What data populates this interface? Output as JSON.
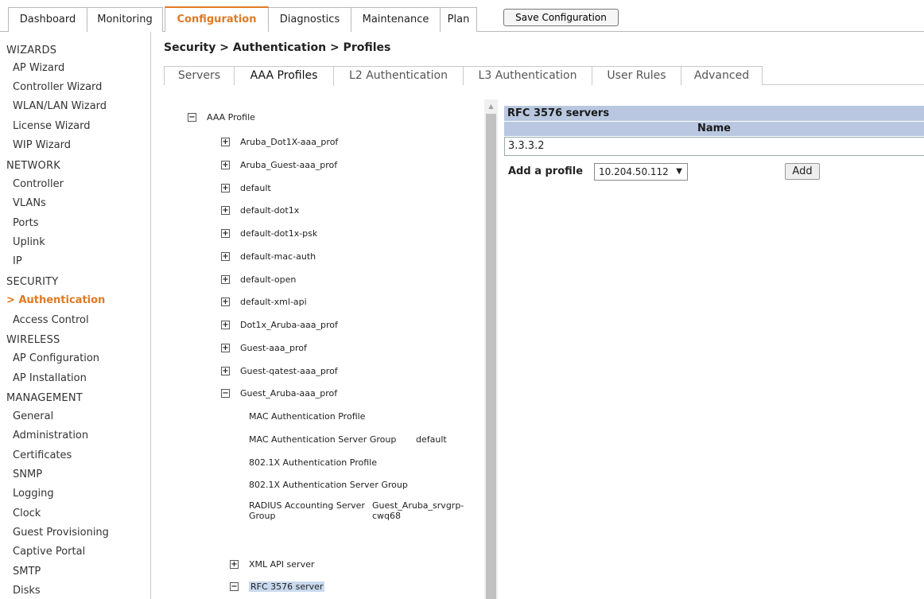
{
  "topnav": {
    "tabs": [
      {
        "label": "Dashboard"
      },
      {
        "label": "Monitoring"
      },
      {
        "label": "Configuration"
      },
      {
        "label": "Diagnostics"
      },
      {
        "label": "Maintenance"
      },
      {
        "label": "Plan"
      }
    ],
    "active_tab": "Configuration",
    "save_label": "Save Configuration"
  },
  "sidebar": {
    "sections": [
      {
        "title": "WIZARDS",
        "items": [
          "AP Wizard",
          "Controller Wizard",
          "WLAN/LAN Wizard",
          "License Wizard",
          "WIP Wizard"
        ]
      },
      {
        "title": "NETWORK",
        "items": [
          "Controller",
          "VLANs",
          "Ports",
          "Uplink",
          "IP"
        ]
      },
      {
        "title": "SECURITY",
        "items": [
          "Authentication",
          "Access Control"
        ]
      },
      {
        "title": "WIRELESS",
        "items": [
          "AP Configuration",
          "AP Installation"
        ]
      },
      {
        "title": "MANAGEMENT",
        "items": [
          "General",
          "Administration",
          "Certificates",
          "SNMP",
          "Logging",
          "Clock",
          "Guest Provisioning",
          "Captive Portal",
          "SMTP",
          "Disks"
        ]
      }
    ],
    "active_marker": ">",
    "active_item": "Authentication"
  },
  "breadcrumb": "Security > Authentication > Profiles",
  "subtabs": [
    {
      "label": "Servers"
    },
    {
      "label": "AAA Profiles"
    },
    {
      "label": "L2 Authentication"
    },
    {
      "label": "L3 Authentication"
    },
    {
      "label": "User Rules"
    },
    {
      "label": "Advanced"
    }
  ],
  "tree": {
    "root": "AAA Profile",
    "collapsed_profiles": [
      "Aruba_Dot1X-aaa_prof",
      "Aruba_Guest-aaa_prof",
      "default",
      "default-dot1x",
      "default-dot1x-psk",
      "default-mac-auth",
      "default-open",
      "default-xml-api",
      "Dot1x_Aruba-aaa_prof",
      "Guest-aaa_prof",
      "Guest-qatest-aaa_prof"
    ],
    "expanded_profile": "Guest_Aruba-aaa_prof",
    "children": [
      {
        "label": "MAC Authentication Profile",
        "value": ""
      },
      {
        "label": "MAC Authentication Server Group",
        "value": "default"
      },
      {
        "label": "802.1X Authentication Profile",
        "value": ""
      },
      {
        "label": "802.1X Authentication Server Group",
        "value": ""
      },
      {
        "label_line1": "RADIUS Accounting Server",
        "label_line2": "Group",
        "value_line1": "Guest_Aruba_srvgrp-",
        "value_line2": "cwq68"
      }
    ],
    "xml_api": "XML API server",
    "rfc_node": "RFC 3576 server",
    "expand_symbol": "+",
    "collapse_symbol": "−"
  },
  "rfc_panel": {
    "title": "RFC 3576 servers",
    "column": "Name",
    "rows": [
      "3.3.3.2"
    ],
    "add_label": "Add a profile",
    "selected": "10.204.50.112",
    "add_button": "Add"
  }
}
